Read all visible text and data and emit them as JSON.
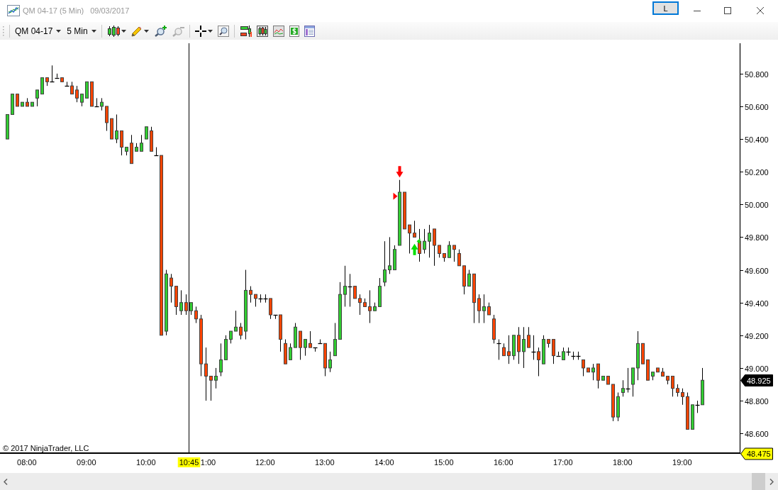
{
  "window": {
    "title": "QM 04-17 (5 Min)",
    "date": "09/03/2017",
    "link_button": "L"
  },
  "toolbar": {
    "instrument": "QM 04-17",
    "interval": "5 Min",
    "tool_groups": [
      [
        {
          "kind": "candles",
          "menu": true,
          "disabled": false
        },
        {
          "kind": "pencil",
          "menu": true,
          "disabled": false
        },
        {
          "kind": "zoomin",
          "menu": false,
          "disabled": false
        },
        {
          "kind": "zoomout",
          "menu": false,
          "disabled": true
        }
      ],
      [
        {
          "kind": "crosshair",
          "menu": true,
          "disabled": false
        },
        {
          "kind": "magnifier",
          "menu": false,
          "disabled": false
        }
      ],
      [
        {
          "kind": "strategies",
          "menu": false,
          "disabled": false
        },
        {
          "kind": "chartstyle",
          "menu": false,
          "disabled": false
        },
        {
          "kind": "indicators",
          "menu": false,
          "disabled": false
        },
        {
          "kind": "dollar",
          "menu": false,
          "disabled": false
        },
        {
          "kind": "properties",
          "menu": false,
          "disabled": false
        }
      ]
    ]
  },
  "chart": {
    "copyright": "© 2017 NinjaTrader, LLC",
    "chart_data": [
      {
        "type": "candlestick",
        "xlim": [
          "2017-09-03T07:33",
          "2017-09-03T19:58"
        ],
        "ylim": [
          48.475,
          50.99
        ],
        "xticks": [
          {
            "value": "2017-09-03T08:00",
            "label": "08:00"
          },
          {
            "value": "2017-09-03T09:00",
            "label": "09:00"
          },
          {
            "value": "2017-09-03T10:00",
            "label": "10:00"
          },
          {
            "value": "2017-09-03T11:00",
            "label": "1:00"
          },
          {
            "value": "2017-09-03T12:00",
            "label": "12:00"
          },
          {
            "value": "2017-09-03T13:00",
            "label": "13:00"
          },
          {
            "value": "2017-09-03T14:00",
            "label": "14:00"
          },
          {
            "value": "2017-09-03T15:00",
            "label": "15:00"
          },
          {
            "value": "2017-09-03T16:00",
            "label": "16:00"
          },
          {
            "value": "2017-09-03T17:00",
            "label": "17:00"
          },
          {
            "value": "2017-09-03T18:00",
            "label": "18:00"
          },
          {
            "value": "2017-09-03T19:00",
            "label": "19:00"
          }
        ],
        "yticks": [
          {
            "value": 50.8,
            "label": "50.800"
          },
          {
            "value": 50.6,
            "label": "50.600"
          },
          {
            "value": 50.4,
            "label": "50.400"
          },
          {
            "value": 50.2,
            "label": "50.200"
          },
          {
            "value": 50.0,
            "label": "50.000"
          },
          {
            "value": 49.8,
            "label": "49.800"
          },
          {
            "value": 49.6,
            "label": "49.600"
          },
          {
            "value": 49.4,
            "label": "49.400"
          },
          {
            "value": 49.2,
            "label": "49.200"
          },
          {
            "value": 49.0,
            "label": "49.000"
          },
          {
            "value": 48.8,
            "label": "48.800"
          },
          {
            "value": 48.6,
            "label": "48.600"
          }
        ],
        "ref_lines": [
          {
            "axis": "x",
            "value": "2017-09-03T10:45",
            "label": "10:45"
          }
        ],
        "annotations": [
          "48.925",
          "48.475"
        ],
        "x": [
          "2017-09-03T07:40",
          "2017-09-03T07:45",
          "2017-09-03T07:50",
          "2017-09-03T07:55",
          "2017-09-03T08:00",
          "2017-09-03T08:05",
          "2017-09-03T08:10",
          "2017-09-03T08:15",
          "2017-09-03T08:20",
          "2017-09-03T08:25",
          "2017-09-03T08:30",
          "2017-09-03T08:35",
          "2017-09-03T08:40",
          "2017-09-03T08:45",
          "2017-09-03T08:50",
          "2017-09-03T08:55",
          "2017-09-03T09:00",
          "2017-09-03T09:05",
          "2017-09-03T09:10",
          "2017-09-03T09:15",
          "2017-09-03T09:20",
          "2017-09-03T09:25",
          "2017-09-03T09:30",
          "2017-09-03T09:35",
          "2017-09-03T09:40",
          "2017-09-03T09:45",
          "2017-09-03T09:50",
          "2017-09-03T09:55",
          "2017-09-03T10:00",
          "2017-09-03T10:05",
          "2017-09-03T10:10",
          "2017-09-03T10:15",
          "2017-09-03T10:20",
          "2017-09-03T10:25",
          "2017-09-03T10:30",
          "2017-09-03T10:35",
          "2017-09-03T10:40",
          "2017-09-03T10:45",
          "2017-09-03T10:50",
          "2017-09-03T10:55",
          "2017-09-03T11:00",
          "2017-09-03T11:05",
          "2017-09-03T11:10",
          "2017-09-03T11:15",
          "2017-09-03T11:20",
          "2017-09-03T11:25",
          "2017-09-03T11:30",
          "2017-09-03T11:35",
          "2017-09-03T11:40",
          "2017-09-03T11:45",
          "2017-09-03T11:50",
          "2017-09-03T11:55",
          "2017-09-03T12:00",
          "2017-09-03T12:05",
          "2017-09-03T12:10",
          "2017-09-03T12:15",
          "2017-09-03T12:20",
          "2017-09-03T12:25",
          "2017-09-03T12:30",
          "2017-09-03T12:35",
          "2017-09-03T12:40",
          "2017-09-03T12:45",
          "2017-09-03T12:50",
          "2017-09-03T12:55",
          "2017-09-03T13:00",
          "2017-09-03T13:05",
          "2017-09-03T13:10",
          "2017-09-03T13:15",
          "2017-09-03T13:20",
          "2017-09-03T13:25",
          "2017-09-03T13:30",
          "2017-09-03T13:35",
          "2017-09-03T13:40",
          "2017-09-03T13:45",
          "2017-09-03T13:50",
          "2017-09-03T13:55",
          "2017-09-03T14:00",
          "2017-09-03T14:05",
          "2017-09-03T14:10",
          "2017-09-03T14:15",
          "2017-09-03T14:20",
          "2017-09-03T14:25",
          "2017-09-03T14:30",
          "2017-09-03T14:35",
          "2017-09-03T14:40",
          "2017-09-03T14:45",
          "2017-09-03T14:50",
          "2017-09-03T14:55",
          "2017-09-03T15:00",
          "2017-09-03T15:05",
          "2017-09-03T15:10",
          "2017-09-03T15:15",
          "2017-09-03T15:20",
          "2017-09-03T15:25",
          "2017-09-03T15:30",
          "2017-09-03T15:35",
          "2017-09-03T15:40",
          "2017-09-03T15:45",
          "2017-09-03T15:50",
          "2017-09-03T15:55",
          "2017-09-03T16:00",
          "2017-09-03T16:05",
          "2017-09-03T16:10",
          "2017-09-03T16:15",
          "2017-09-03T16:20",
          "2017-09-03T16:25",
          "2017-09-03T16:30",
          "2017-09-03T16:35",
          "2017-09-03T16:40",
          "2017-09-03T16:45",
          "2017-09-03T16:50",
          "2017-09-03T16:55",
          "2017-09-03T17:00",
          "2017-09-03T17:05",
          "2017-09-03T17:10",
          "2017-09-03T17:15",
          "2017-09-03T17:20",
          "2017-09-03T17:25",
          "2017-09-03T17:30",
          "2017-09-03T17:35",
          "2017-09-03T17:40",
          "2017-09-03T17:45",
          "2017-09-03T17:50",
          "2017-09-03T17:55",
          "2017-09-03T18:00",
          "2017-09-03T18:05",
          "2017-09-03T18:10",
          "2017-09-03T18:15",
          "2017-09-03T18:20",
          "2017-09-03T18:25",
          "2017-09-03T18:30",
          "2017-09-03T18:35",
          "2017-09-03T18:40",
          "2017-09-03T18:45",
          "2017-09-03T18:50",
          "2017-09-03T18:55",
          "2017-09-03T19:00",
          "2017-09-03T19:05",
          "2017-09-03T19:10",
          "2017-09-03T19:15",
          "2017-09-03T19:20"
        ],
        "ohlc": [
          [
            50.4,
            50.55,
            50.4,
            50.55
          ],
          [
            50.55,
            50.675,
            50.55,
            50.675
          ],
          [
            50.675,
            50.675,
            50.6,
            50.6
          ],
          [
            50.6,
            50.625,
            50.6,
            50.625
          ],
          [
            50.625,
            50.65,
            50.6,
            50.6
          ],
          [
            50.6,
            50.625,
            50.6,
            50.625
          ],
          [
            50.65,
            50.7,
            50.6,
            50.7
          ],
          [
            50.675,
            50.775,
            50.675,
            50.775
          ],
          [
            50.775,
            50.775,
            50.725,
            50.75
          ],
          [
            50.75,
            50.85,
            50.75,
            50.75
          ],
          [
            50.775,
            50.8,
            50.775,
            50.775
          ],
          [
            50.775,
            50.775,
            50.75,
            50.75
          ],
          [
            50.725,
            50.75,
            50.725,
            50.725
          ],
          [
            50.725,
            50.75,
            50.675,
            50.675
          ],
          [
            50.7,
            50.725,
            50.625,
            50.65
          ],
          [
            50.625,
            50.675,
            50.6,
            50.675
          ],
          [
            50.65,
            50.75,
            50.65,
            50.75
          ],
          [
            50.75,
            50.75,
            50.6,
            50.6
          ],
          [
            50.6,
            50.65,
            50.6,
            50.6
          ],
          [
            50.6,
            50.65,
            50.575,
            50.625
          ],
          [
            50.6,
            50.6,
            50.45,
            50.5
          ],
          [
            50.525,
            50.525,
            50.4,
            50.4
          ],
          [
            50.4,
            50.55,
            50.375,
            50.45
          ],
          [
            50.45,
            50.45,
            50.3,
            50.35
          ],
          [
            50.325,
            50.35,
            50.3,
            50.35
          ],
          [
            50.375,
            50.425,
            50.25,
            50.25
          ],
          [
            50.325,
            50.375,
            50.325,
            50.35
          ],
          [
            50.325,
            50.425,
            50.325,
            50.375
          ],
          [
            50.4,
            50.475,
            50.4,
            50.475
          ],
          [
            50.45,
            50.475,
            50.325,
            50.325
          ],
          [
            50.3,
            50.35,
            50.3,
            50.3
          ],
          [
            50.3,
            50.3,
            49.2,
            49.2
          ],
          [
            49.225,
            49.6,
            49.2,
            49.575
          ],
          [
            49.55,
            49.575,
            49.4,
            49.5
          ],
          [
            49.5,
            49.5,
            49.325,
            49.375
          ],
          [
            49.35,
            49.475,
            49.325,
            49.4
          ],
          [
            49.4,
            49.45,
            49.325,
            49.35
          ],
          [
            49.35,
            49.4,
            49.325,
            49.4
          ],
          [
            49.35,
            49.375,
            49.275,
            49.3
          ],
          [
            49.3,
            49.325,
            48.95,
            49.025
          ],
          [
            49.025,
            49.125,
            48.8,
            48.95
          ],
          [
            48.95,
            48.95,
            48.8,
            48.925
          ],
          [
            48.925,
            49.0,
            48.875,
            48.95
          ],
          [
            48.975,
            49.15,
            48.95,
            49.05
          ],
          [
            49.05,
            49.2,
            49.05,
            49.175
          ],
          [
            49.175,
            49.225,
            49.15,
            49.225
          ],
          [
            49.225,
            49.35,
            49.225,
            49.25
          ],
          [
            49.25,
            49.275,
            49.175,
            49.2
          ],
          [
            49.225,
            49.6,
            49.175,
            49.475
          ],
          [
            49.475,
            49.5,
            49.4,
            49.45
          ],
          [
            49.45,
            49.45,
            49.375,
            49.425
          ],
          [
            49.425,
            49.45,
            49.4,
            49.425
          ],
          [
            49.425,
            49.45,
            49.4,
            49.425
          ],
          [
            49.425,
            49.425,
            49.3,
            49.325
          ],
          [
            49.325,
            49.325,
            49.3,
            49.325
          ],
          [
            49.325,
            49.325,
            49.1,
            49.175
          ],
          [
            49.15,
            49.175,
            49.025,
            49.025
          ],
          [
            49.05,
            49.15,
            49.05,
            49.125
          ],
          [
            49.125,
            49.275,
            49.125,
            49.25
          ],
          [
            49.225,
            49.225,
            49.05,
            49.125
          ],
          [
            49.125,
            49.175,
            49.075,
            49.175
          ],
          [
            49.15,
            49.225,
            49.125,
            49.125
          ],
          [
            49.125,
            49.125,
            49.1,
            49.125
          ],
          [
            49.15,
            49.175,
            49.15,
            49.15
          ],
          [
            49.15,
            49.15,
            48.95,
            49.0
          ],
          [
            49.0,
            49.1,
            48.975,
            49.05
          ],
          [
            49.075,
            49.275,
            49.075,
            49.175
          ],
          [
            49.175,
            49.525,
            49.175,
            49.45
          ],
          [
            49.45,
            49.625,
            49.375,
            49.5
          ],
          [
            49.5,
            49.575,
            49.375,
            49.5
          ],
          [
            49.5,
            49.5,
            49.425,
            49.425
          ],
          [
            49.425,
            49.45,
            49.325,
            49.4
          ],
          [
            49.4,
            49.425,
            49.375,
            49.375
          ],
          [
            49.375,
            49.475,
            49.275,
            49.35
          ],
          [
            49.35,
            49.4,
            49.35,
            49.375
          ],
          [
            49.375,
            49.55,
            49.375,
            49.5
          ],
          [
            49.525,
            49.775,
            49.5,
            49.6
          ],
          [
            49.6,
            49.8,
            49.575,
            49.625
          ],
          [
            49.6,
            49.75,
            49.6,
            49.725
          ],
          [
            49.75,
            50.15,
            49.75,
            50.075
          ],
          [
            50.075,
            50.075,
            49.85,
            49.85
          ],
          [
            49.875,
            49.875,
            49.7,
            49.825
          ],
          [
            49.825,
            49.9,
            49.8,
            49.8
          ],
          [
            49.775,
            49.85,
            49.65,
            49.7
          ],
          [
            49.725,
            49.85,
            49.7,
            49.775
          ],
          [
            49.775,
            49.875,
            49.675,
            49.825
          ],
          [
            49.85,
            49.85,
            49.625,
            49.75
          ],
          [
            49.75,
            49.75,
            49.675,
            49.7
          ],
          [
            49.7,
            49.7,
            49.65,
            49.675
          ],
          [
            49.675,
            49.775,
            49.675,
            49.75
          ],
          [
            49.75,
            49.75,
            49.65,
            49.725
          ],
          [
            49.7,
            49.725,
            49.625,
            49.625
          ],
          [
            49.625,
            49.625,
            49.45,
            49.5
          ],
          [
            49.5,
            49.6,
            49.5,
            49.575
          ],
          [
            49.575,
            49.575,
            49.275,
            49.4
          ],
          [
            49.425,
            49.45,
            49.275,
            49.35
          ],
          [
            49.35,
            49.45,
            49.275,
            49.375
          ],
          [
            49.375,
            49.4,
            49.325,
            49.325
          ],
          [
            49.3,
            49.325,
            49.15,
            49.175
          ],
          [
            49.15,
            49.175,
            49.05,
            49.15
          ],
          [
            49.125,
            49.15,
            49.075,
            49.075
          ],
          [
            49.1,
            49.2,
            49.025,
            49.075
          ],
          [
            49.075,
            49.2,
            49.05,
            49.2
          ],
          [
            49.2,
            49.25,
            49.025,
            49.1
          ],
          [
            49.1,
            49.25,
            49.0,
            49.175
          ],
          [
            49.2,
            49.25,
            49.125,
            49.125
          ],
          [
            49.1,
            49.2,
            49.05,
            49.1
          ],
          [
            49.1,
            49.125,
            48.95,
            49.05
          ],
          [
            49.025,
            49.2,
            49.025,
            49.175
          ],
          [
            49.175,
            49.175,
            49.125,
            49.15
          ],
          [
            49.175,
            49.175,
            49.025,
            49.075
          ],
          [
            49.075,
            49.1,
            49.075,
            49.075
          ],
          [
            49.05,
            49.125,
            49.05,
            49.1
          ],
          [
            49.1,
            49.125,
            49.075,
            49.1
          ],
          [
            49.075,
            49.1,
            49.05,
            49.075
          ],
          [
            49.075,
            49.1,
            49.05,
            49.075
          ],
          [
            49.05,
            49.05,
            48.95,
            49.0
          ],
          [
            49.0,
            49.0,
            48.975,
            48.975
          ],
          [
            48.975,
            49.025,
            48.925,
            49.0
          ],
          [
            49.025,
            49.025,
            48.875,
            48.925
          ],
          [
            48.925,
            48.95,
            48.925,
            48.95
          ],
          [
            48.95,
            48.95,
            48.9,
            48.9
          ],
          [
            48.9,
            48.9,
            48.675,
            48.7
          ],
          [
            48.7,
            48.85,
            48.675,
            48.825
          ],
          [
            48.85,
            48.925,
            48.825,
            48.875
          ],
          [
            48.875,
            49.0,
            48.85,
            48.875
          ],
          [
            48.9,
            49.0,
            48.825,
            49.0
          ],
          [
            49.0,
            49.225,
            48.925,
            49.15
          ],
          [
            49.15,
            49.15,
            49.025,
            49.025
          ],
          [
            49.05,
            49.05,
            48.925,
            48.925
          ],
          [
            48.95,
            48.975,
            48.925,
            48.975
          ],
          [
            49.0,
            49.0,
            48.975,
            48.975
          ],
          [
            48.975,
            49.0,
            48.95,
            48.95
          ],
          [
            48.95,
            48.95,
            48.9,
            48.925
          ],
          [
            48.95,
            48.95,
            48.825,
            48.875
          ],
          [
            48.875,
            48.9,
            48.825,
            48.85
          ],
          [
            48.85,
            48.875,
            48.775,
            48.825
          ],
          [
            48.825,
            48.85,
            48.625,
            48.625
          ],
          [
            48.625,
            48.775,
            48.625,
            48.775
          ],
          [
            48.775,
            48.8,
            48.725,
            48.775
          ],
          [
            48.775,
            49.0,
            48.775,
            48.925
          ]
        ]
      }
    ]
  }
}
